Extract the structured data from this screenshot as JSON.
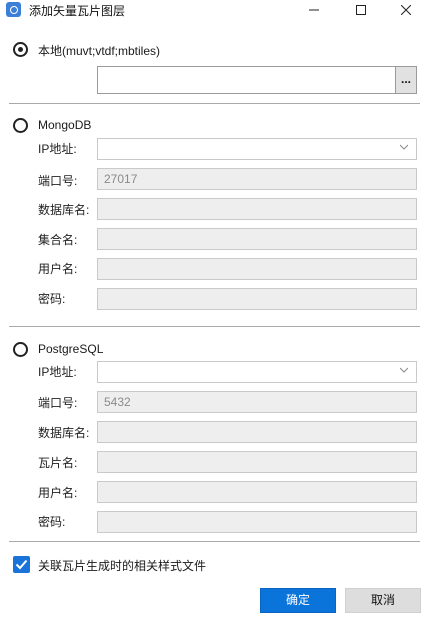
{
  "window": {
    "title": "添加矢量瓦片图层",
    "app_icon": "map-icon"
  },
  "local": {
    "label": "本地(muvt;vtdf;mbtiles)",
    "selected": true,
    "path_value": "",
    "browse_label": "..."
  },
  "mongodb": {
    "label": "MongoDB",
    "selected": false,
    "fields": {
      "ip_label": "IP地址:",
      "ip_value": "",
      "port_label": "端口号:",
      "port_value": "27017",
      "database_label": "数据库名:",
      "database_value": "",
      "collection_label": "集合名:",
      "collection_value": "",
      "user_label": "用户名:",
      "user_value": "",
      "password_label": "密码:",
      "password_value": ""
    }
  },
  "postgresql": {
    "label": "PostgreSQL",
    "selected": false,
    "fields": {
      "ip_label": "IP地址:",
      "ip_value": "",
      "port_label": "端口号:",
      "port_value": "5432",
      "database_label": "数据库名:",
      "database_value": "",
      "tile_label": "瓦片名:",
      "tile_value": "",
      "user_label": "用户名:",
      "user_value": "",
      "password_label": "密码:",
      "password_value": ""
    }
  },
  "options": {
    "associate_style_label": "关联瓦片生成时的相关样式文件",
    "associate_style_checked": true
  },
  "buttons": {
    "ok_label": "确定",
    "cancel_label": "取消"
  },
  "colors": {
    "accent": "#0a74da",
    "checkbox": "#1a73d9",
    "disabled_field": "#eeeeee"
  }
}
